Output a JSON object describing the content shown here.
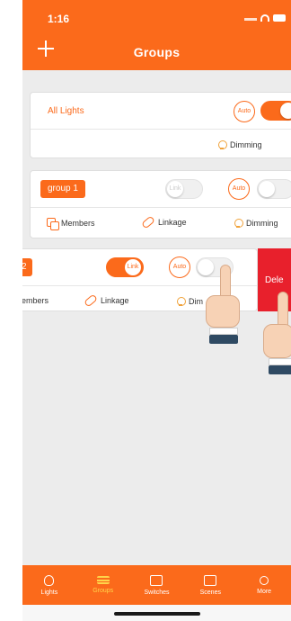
{
  "status": {
    "time": "1:16"
  },
  "header": {
    "title": "Groups"
  },
  "cards": {
    "all_lights": {
      "name": "All Lights",
      "auto_label": "Auto",
      "dimming_label": "Dimming"
    },
    "group1": {
      "name": "group 1",
      "link_label": "Link",
      "auto_label": "Auto",
      "members_label": "Members",
      "linkage_label": "Linkage",
      "dimming_label": "Dimming"
    },
    "group2": {
      "name": "2",
      "link_label": "Link",
      "auto_label": "Auto",
      "members_label": "embers",
      "linkage_label": "Linkage",
      "dimming_label": "Dim",
      "delete_label": "Dele"
    }
  },
  "tabs": [
    {
      "label": "Lights",
      "icon": "bulb-icon"
    },
    {
      "label": "Groups",
      "icon": "groups-icon"
    },
    {
      "label": "Switches",
      "icon": "switch-icon"
    },
    {
      "label": "Scenes",
      "icon": "scene-icon"
    },
    {
      "label": "More",
      "icon": "share-icon"
    }
  ],
  "active_tab": "Groups",
  "colors": {
    "brand": "#fb6a1b",
    "active_tab": "#ffd54a",
    "delete": "#e8202c"
  }
}
